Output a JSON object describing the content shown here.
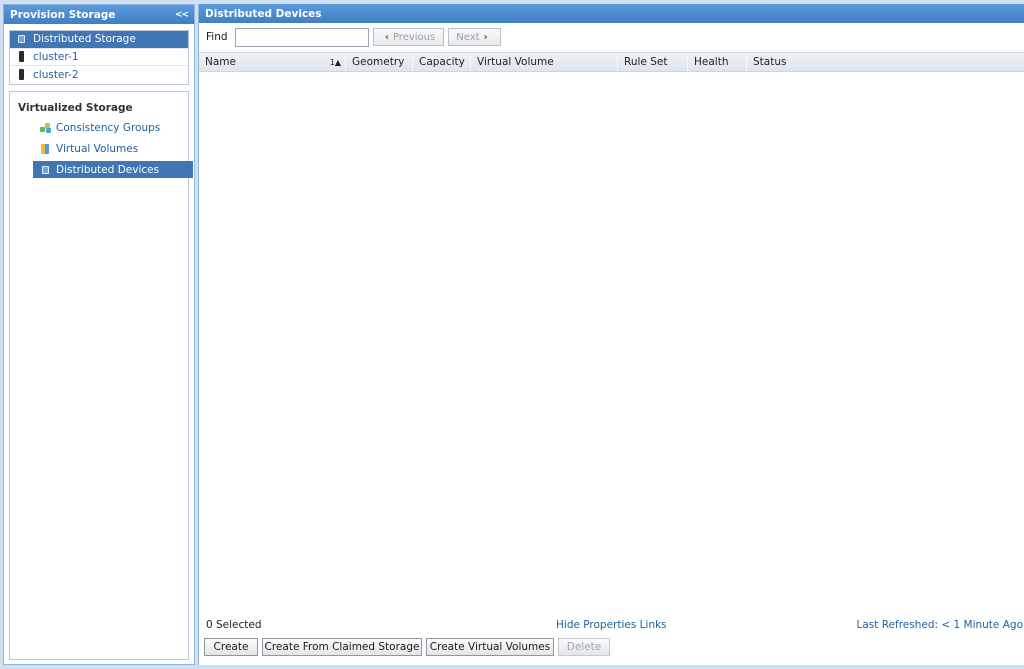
{
  "left_panel": {
    "title": "Provision Storage",
    "collapse_label": "<<",
    "storage_items": [
      {
        "label": "Distributed Storage",
        "icon": "distributed-storage-icon",
        "selected": true
      },
      {
        "label": "cluster-1",
        "icon": "cluster-icon",
        "selected": false
      },
      {
        "label": "cluster-2",
        "icon": "cluster-icon",
        "selected": false
      }
    ],
    "virtualized": {
      "title": "Virtualized Storage",
      "items": [
        {
          "label": "Consistency Groups",
          "icon": "consistency-groups-icon",
          "selected": false
        },
        {
          "label": "Virtual Volumes",
          "icon": "virtual-volumes-icon",
          "selected": false
        },
        {
          "label": "Distributed Devices",
          "icon": "distributed-devices-icon",
          "selected": true
        }
      ]
    }
  },
  "right_panel": {
    "title": "Distributed Devices",
    "find_label": "Find",
    "find_value": "",
    "previous_label": "Previous",
    "next_label": "Next",
    "columns": {
      "name": "Name",
      "sort_indicator": "1▲",
      "geometry": "Geometry",
      "capacity": "Capacity",
      "virtual_volume": "Virtual Volume",
      "rule_set": "Rule Set",
      "health": "Health",
      "status": "Status"
    },
    "rows": [],
    "selected_count": "0 Selected",
    "hide_properties_links": "Hide Properties Links",
    "last_refreshed": "Last Refreshed: < 1 Minute Ago",
    "actions": {
      "create": "Create",
      "create_from_claimed": "Create From Claimed Storage",
      "create_virtual_volumes": "Create Virtual Volumes",
      "delete": "Delete"
    }
  },
  "colors": {
    "header_blue": "#4f8fd0",
    "selection_blue": "#3f76b3",
    "link_blue": "#1f5fa6"
  }
}
